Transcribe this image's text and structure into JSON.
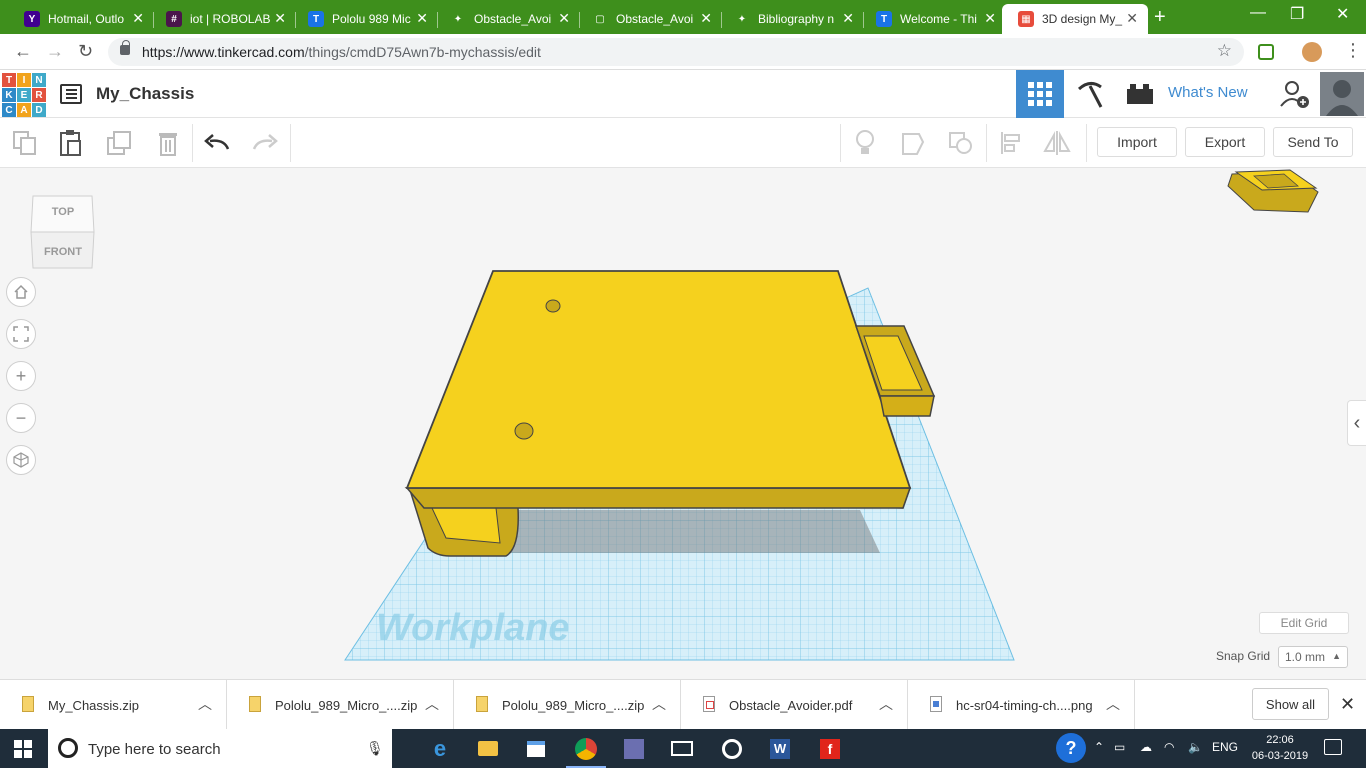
{
  "browser": {
    "tabs": [
      {
        "label": "Hotmail, Outlo",
        "icon": "yahoo-icon",
        "color": "#400090",
        "glyph": "Y"
      },
      {
        "label": "iot | ROBOLAB",
        "icon": "slack-icon",
        "color": "#4a154b",
        "glyph": "#"
      },
      {
        "label": "Pololu 989 Mic",
        "icon": "site-t-icon",
        "color": "#1a73e8",
        "glyph": "T"
      },
      {
        "label": "Obstacle_Avoi",
        "icon": "leaf-icon",
        "color": "#3e8f1c",
        "glyph": "✦"
      },
      {
        "label": "Obstacle_Avoi",
        "icon": "doc-icon",
        "color": "#3e8f1c",
        "glyph": "▢"
      },
      {
        "label": "Bibliography n",
        "icon": "leaf-icon",
        "color": "#3e8f1c",
        "glyph": "✦"
      },
      {
        "label": "Welcome - Thi",
        "icon": "site-t-icon",
        "color": "#1a73e8",
        "glyph": "T"
      },
      {
        "label": "3D design My_",
        "icon": "tinkercad-icon",
        "color": "#e74c3c",
        "glyph": "▦"
      }
    ],
    "active_tab_index": 7,
    "url_host": "https://www.tinkercad.com",
    "url_path": "/things/cmdD75Awn7b-mychassis/edit"
  },
  "app": {
    "logo_letters": [
      {
        "ch": "T",
        "color": "#e2523e"
      },
      {
        "ch": "I",
        "color": "#f1a31c"
      },
      {
        "ch": "N",
        "color": "#3fa9c9"
      },
      {
        "ch": "K",
        "color": "#2d89c8"
      },
      {
        "ch": "E",
        "color": "#3fa9c9"
      },
      {
        "ch": "R",
        "color": "#e2523e"
      },
      {
        "ch": "C",
        "color": "#2d89c8"
      },
      {
        "ch": "A",
        "color": "#f1a31c"
      },
      {
        "ch": "D",
        "color": "#3fa9c9"
      }
    ],
    "design_name": "My_Chassis",
    "whats_new": "What's New",
    "accent_color": "#3f8bd0"
  },
  "toolbar": {
    "import_label": "Import",
    "export_label": "Export",
    "send_to_label": "Send To"
  },
  "viewcube": {
    "top_label": "TOP",
    "front_label": "FRONT"
  },
  "canvas": {
    "workplane_label": "Workplane",
    "edit_grid_label": "Edit Grid",
    "snap_grid_label": "Snap Grid",
    "snap_grid_value": "1.0 mm",
    "shape_color": "#f5d11e",
    "grid_color": "#8fd0ec"
  },
  "downloads": {
    "items": [
      {
        "name": "My_Chassis.zip",
        "type": "zip"
      },
      {
        "name": "Pololu_989_Micro_....zip",
        "type": "zip"
      },
      {
        "name": "Pololu_989_Micro_....zip",
        "type": "zip"
      },
      {
        "name": "Obstacle_Avoider.pdf",
        "type": "pdf"
      },
      {
        "name": "hc-sr04-timing-ch....png",
        "type": "png"
      }
    ],
    "show_all_label": "Show all"
  },
  "taskbar": {
    "search_placeholder": "Type here to search",
    "language": "ENG",
    "time": "22:06",
    "date": "06-03-2019"
  }
}
